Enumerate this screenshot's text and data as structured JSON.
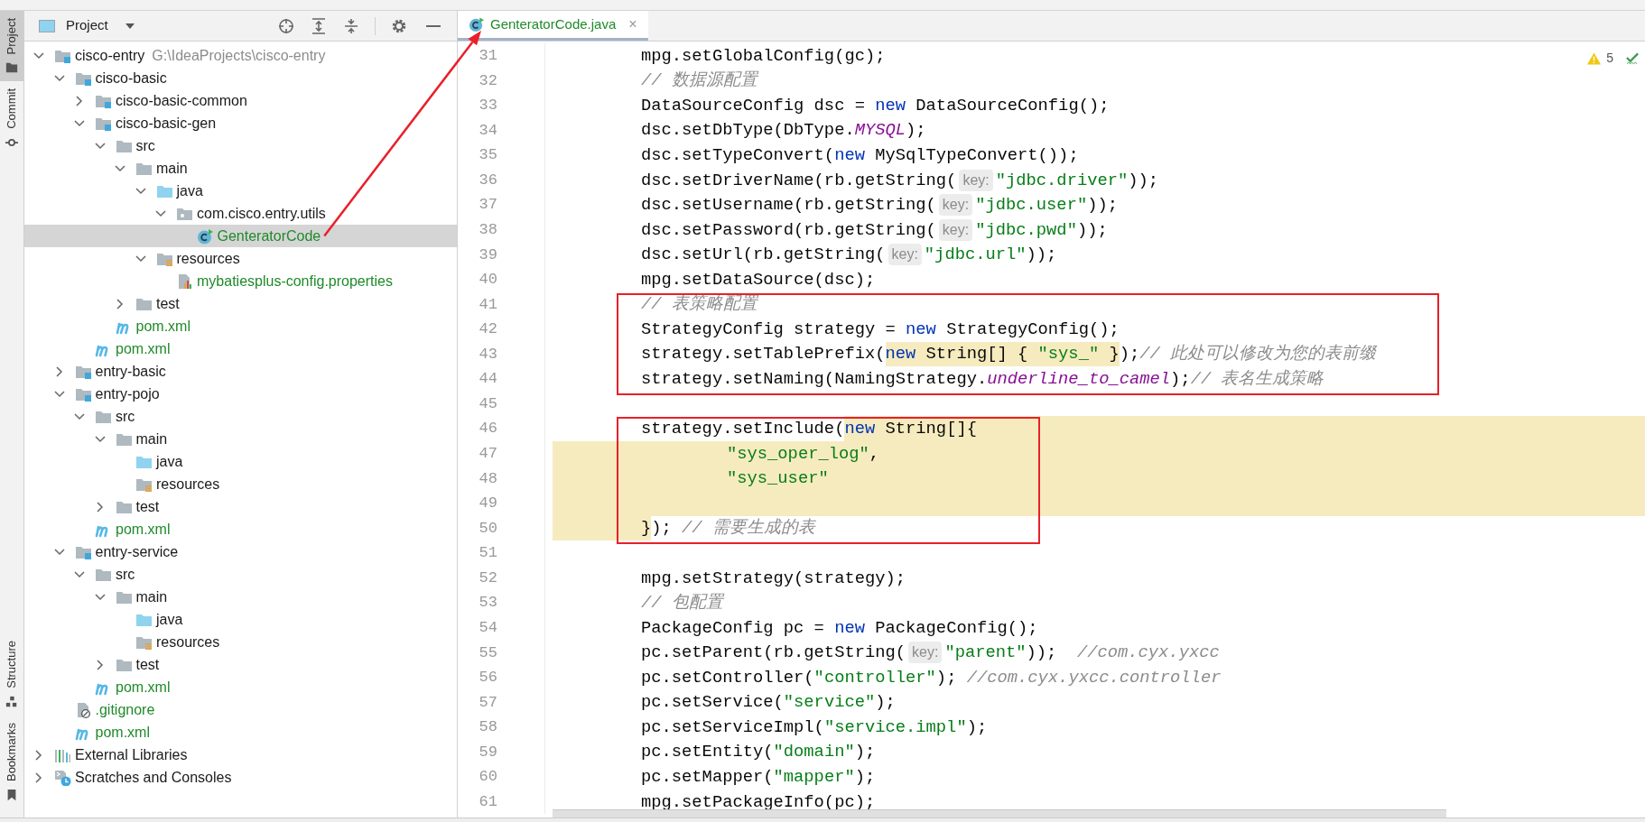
{
  "tool_strip": {
    "top": [
      {
        "label": "Project",
        "kind": "folder",
        "selected": true
      },
      {
        "label": "Commit",
        "kind": "commit",
        "selected": false
      }
    ],
    "bottom": [
      {
        "label": "Structure",
        "kind": "structure",
        "selected": false
      },
      {
        "label": "Bookmarks",
        "kind": "bookmark",
        "selected": false
      }
    ]
  },
  "project_panel": {
    "title": "Project",
    "tree": [
      {
        "name": "cisco-entry",
        "path": "G:\\IdeaProjects\\cisco-entry",
        "kind": "module",
        "expanded": true,
        "selected": false,
        "added": false,
        "children": [
          {
            "name": "cisco-basic",
            "kind": "module",
            "expanded": true,
            "selected": false,
            "added": false,
            "children": [
              {
                "name": "cisco-basic-common",
                "kind": "module",
                "expanded": false,
                "selected": false,
                "added": false
              },
              {
                "name": "cisco-basic-gen",
                "kind": "module",
                "expanded": true,
                "selected": false,
                "added": false,
                "children": [
                  {
                    "name": "src",
                    "kind": "folder",
                    "expanded": true,
                    "selected": false,
                    "added": false,
                    "children": [
                      {
                        "name": "main",
                        "kind": "folder",
                        "expanded": true,
                        "selected": false,
                        "added": false,
                        "children": [
                          {
                            "name": "java",
                            "kind": "source-folder",
                            "expanded": true,
                            "selected": false,
                            "added": false,
                            "children": [
                              {
                                "name": "com.cisco.entry.utils",
                                "kind": "package",
                                "expanded": true,
                                "selected": false,
                                "added": false,
                                "children": [
                                  {
                                    "name": "GenteratorCode",
                                    "kind": "class",
                                    "selected": true,
                                    "added": true
                                  }
                                ]
                              }
                            ]
                          },
                          {
                            "name": "resources",
                            "kind": "resource-folder",
                            "expanded": true,
                            "selected": false,
                            "added": false,
                            "children": [
                              {
                                "name": "mybatiesplus-config.properties",
                                "kind": "properties",
                                "selected": false,
                                "added": true
                              }
                            ]
                          }
                        ]
                      },
                      {
                        "name": "test",
                        "kind": "folder",
                        "expanded": false,
                        "selected": false,
                        "added": false
                      }
                    ]
                  },
                  {
                    "name": "pom.xml",
                    "kind": "maven",
                    "selected": false,
                    "added": true
                  }
                ]
              },
              {
                "name": "pom.xml",
                "kind": "maven",
                "selected": false,
                "added": true
              }
            ]
          },
          {
            "name": "entry-basic",
            "kind": "module",
            "expanded": false,
            "selected": false,
            "added": false
          },
          {
            "name": "entry-pojo",
            "kind": "module",
            "expanded": true,
            "selected": false,
            "added": false,
            "children": [
              {
                "name": "src",
                "kind": "folder",
                "expanded": true,
                "selected": false,
                "added": false,
                "children": [
                  {
                    "name": "main",
                    "kind": "folder",
                    "expanded": true,
                    "selected": false,
                    "added": false,
                    "children": [
                      {
                        "name": "java",
                        "kind": "source-folder",
                        "selected": false,
                        "added": false
                      },
                      {
                        "name": "resources",
                        "kind": "resource-folder",
                        "selected": false,
                        "added": false
                      }
                    ]
                  },
                  {
                    "name": "test",
                    "kind": "folder",
                    "expanded": false,
                    "selected": false,
                    "added": false
                  }
                ]
              },
              {
                "name": "pom.xml",
                "kind": "maven",
                "selected": false,
                "added": true
              }
            ]
          },
          {
            "name": "entry-service",
            "kind": "module",
            "expanded": true,
            "selected": false,
            "added": false,
            "children": [
              {
                "name": "src",
                "kind": "folder",
                "expanded": true,
                "selected": false,
                "added": false,
                "children": [
                  {
                    "name": "main",
                    "kind": "folder",
                    "expanded": true,
                    "selected": false,
                    "added": false,
                    "children": [
                      {
                        "name": "java",
                        "kind": "source-folder",
                        "selected": false,
                        "added": false
                      },
                      {
                        "name": "resources",
                        "kind": "resource-folder",
                        "selected": false,
                        "added": false
                      }
                    ]
                  },
                  {
                    "name": "test",
                    "kind": "folder",
                    "expanded": false,
                    "selected": false,
                    "added": false
                  }
                ]
              },
              {
                "name": "pom.xml",
                "kind": "maven",
                "selected": false,
                "added": true
              }
            ]
          },
          {
            "name": ".gitignore",
            "kind": "gitignore",
            "selected": false,
            "added": true
          },
          {
            "name": "pom.xml",
            "kind": "maven",
            "selected": false,
            "added": true
          }
        ]
      },
      {
        "name": "External Libraries",
        "kind": "libraries",
        "expanded": false,
        "selected": false,
        "added": false
      },
      {
        "name": "Scratches and Consoles",
        "kind": "scratches",
        "expanded": false,
        "selected": false,
        "added": false
      }
    ]
  },
  "editor": {
    "tabs": [
      {
        "label": "GenteratorCode.java",
        "close": "×",
        "selected": true,
        "added": true
      }
    ],
    "inspections": {
      "warnings": "5"
    },
    "sections": [
      {
        "outlined": false,
        "lines": [
          {
            "number": "31",
            "tokens": [
              {
                "kind": "plain",
                "text": "mpg.setGlobalConfig(gc);"
              }
            ]
          },
          {
            "number": "32",
            "tokens": [
              {
                "kind": "comment",
                "text": "// 数据源配置"
              }
            ]
          },
          {
            "number": "33",
            "tokens": [
              {
                "kind": "plain",
                "text": "DataSourceConfig dsc = "
              },
              {
                "kind": "keyword",
                "text": "new"
              },
              {
                "kind": "plain",
                "text": " DataSourceConfig();"
              }
            ]
          },
          {
            "number": "34",
            "tokens": [
              {
                "kind": "plain",
                "text": "dsc.setDbType(DbType."
              },
              {
                "kind": "static",
                "text": "MYSQL"
              },
              {
                "kind": "plain",
                "text": ");"
              }
            ]
          },
          {
            "number": "35",
            "tokens": [
              {
                "kind": "plain",
                "text": "dsc.setTypeConvert("
              },
              {
                "kind": "keyword",
                "text": "new"
              },
              {
                "kind": "plain",
                "text": " MySqlTypeConvert());"
              }
            ]
          },
          {
            "number": "36",
            "tokens": [
              {
                "kind": "plain",
                "text": "dsc.setDriverName(rb.getString("
              },
              {
                "kind": "hint",
                "text": "key:"
              },
              {
                "kind": "string",
                "text": "\"jdbc.driver\""
              },
              {
                "kind": "plain",
                "text": "));"
              }
            ]
          },
          {
            "number": "37",
            "tokens": [
              {
                "kind": "plain",
                "text": "dsc.setUsername(rb.getString("
              },
              {
                "kind": "hint",
                "text": "key:"
              },
              {
                "kind": "string",
                "text": "\"jdbc.user\""
              },
              {
                "kind": "plain",
                "text": "));"
              }
            ]
          },
          {
            "number": "38",
            "tokens": [
              {
                "kind": "plain",
                "text": "dsc.setPassword(rb.getString("
              },
              {
                "kind": "hint",
                "text": "key:"
              },
              {
                "kind": "string",
                "text": "\"jdbc.pwd\""
              },
              {
                "kind": "plain",
                "text": "));"
              }
            ]
          },
          {
            "number": "39",
            "tokens": [
              {
                "kind": "plain",
                "text": "dsc.setUrl(rb.getString("
              },
              {
                "kind": "hint",
                "text": "key:"
              },
              {
                "kind": "string",
                "text": "\"jdbc.url\""
              },
              {
                "kind": "plain",
                "text": "));"
              }
            ]
          },
          {
            "number": "40",
            "tokens": [
              {
                "kind": "plain",
                "text": "mpg.setDataSource(dsc);"
              }
            ]
          }
        ]
      },
      {
        "outlined": true,
        "lines": [
          {
            "number": "41",
            "tokens": [
              {
                "kind": "comment",
                "text": "// 表策略配置"
              }
            ]
          },
          {
            "number": "42",
            "tokens": [
              {
                "kind": "plain",
                "text": "StrategyConfig strategy = "
              },
              {
                "kind": "keyword",
                "text": "new"
              },
              {
                "kind": "plain",
                "text": " StrategyConfig();"
              }
            ]
          },
          {
            "number": "43",
            "tokens": [
              {
                "kind": "plain",
                "text": "strategy.setTablePrefix("
              },
              {
                "kind": "keyword",
                "text": "new",
                "marked": true
              },
              {
                "kind": "plain",
                "text": " String[] { ",
                "marked": true
              },
              {
                "kind": "string",
                "text": "\"sys_\"",
                "marked": true
              },
              {
                "kind": "plain",
                "text": " }",
                "marked": true
              },
              {
                "kind": "plain",
                "text": ");"
              },
              {
                "kind": "comment",
                "text": "// 此处可以修改为您的表前缀"
              }
            ]
          },
          {
            "number": "44",
            "tokens": [
              {
                "kind": "plain",
                "text": "strategy.setNaming(NamingStrategy."
              },
              {
                "kind": "static",
                "text": "underline_to_camel"
              },
              {
                "kind": "plain",
                "text": ");"
              },
              {
                "kind": "comment",
                "text": "// 表名生成策略"
              }
            ]
          }
        ]
      },
      {
        "outlined": false,
        "lines": [
          {
            "number": "45",
            "kind": "code"
          }
        ]
      },
      {
        "outlined": true,
        "lines": [
          {
            "number": "46",
            "kind": "marked-tail",
            "tokens": [
              {
                "kind": "plain",
                "text": "strategy.setInclude("
              },
              {
                "kind": "keyword",
                "text": "new",
                "marked": true
              },
              {
                "kind": "plain",
                "text": " String[]{",
                "marked": true
              }
            ]
          },
          {
            "number": "47",
            "kind": "marked-full",
            "continuation": true,
            "tokens": [
              {
                "kind": "string",
                "text": "\"sys_oper_log\""
              },
              {
                "kind": "plain",
                "text": ","
              }
            ]
          },
          {
            "number": "48",
            "kind": "marked-full",
            "continuation": true,
            "tokens": [
              {
                "kind": "string",
                "text": "\"sys_user\""
              }
            ]
          },
          {
            "number": "49",
            "kind": "marked-full"
          },
          {
            "number": "50",
            "kind": "marked-head",
            "tokens": [
              {
                "kind": "plain",
                "text": "}",
                "marked": true
              },
              {
                "kind": "plain",
                "text": "); "
              },
              {
                "kind": "comment",
                "text": "// 需要生成的表"
              }
            ]
          }
        ]
      },
      {
        "outlined": false,
        "lines": [
          {
            "number": "51",
            "kind": "code"
          },
          {
            "number": "52",
            "tokens": [
              {
                "kind": "plain",
                "text": "mpg.setStrategy(strategy);"
              }
            ]
          },
          {
            "number": "53",
            "tokens": [
              {
                "kind": "comment",
                "text": "// 包配置"
              }
            ]
          },
          {
            "number": "54",
            "tokens": [
              {
                "kind": "plain",
                "text": "PackageConfig pc = "
              },
              {
                "kind": "keyword",
                "text": "new"
              },
              {
                "kind": "plain",
                "text": " PackageConfig();"
              }
            ]
          },
          {
            "number": "55",
            "tokens": [
              {
                "kind": "plain",
                "text": "pc.setParent(rb.getString("
              },
              {
                "kind": "hint",
                "text": "key:"
              },
              {
                "kind": "string",
                "text": "\"parent\""
              },
              {
                "kind": "plain",
                "text": "));  "
              },
              {
                "kind": "comment",
                "text": "//com.cyx.yxcc"
              }
            ]
          },
          {
            "number": "56",
            "tokens": [
              {
                "kind": "plain",
                "text": "pc.setController("
              },
              {
                "kind": "string",
                "text": "\"controller\""
              },
              {
                "kind": "plain",
                "text": "); "
              },
              {
                "kind": "comment",
                "text": "//com.cyx.yxcc.controller"
              }
            ]
          },
          {
            "number": "57",
            "tokens": [
              {
                "kind": "plain",
                "text": "pc.setService("
              },
              {
                "kind": "string",
                "text": "\"service\""
              },
              {
                "kind": "plain",
                "text": ");"
              }
            ]
          },
          {
            "number": "58",
            "tokens": [
              {
                "kind": "plain",
                "text": "pc.setServiceImpl("
              },
              {
                "kind": "string",
                "text": "\"service.impl\""
              },
              {
                "kind": "plain",
                "text": ");"
              }
            ]
          },
          {
            "number": "59",
            "tokens": [
              {
                "kind": "plain",
                "text": "pc.setEntity("
              },
              {
                "kind": "string",
                "text": "\"domain\""
              },
              {
                "kind": "plain",
                "text": ");"
              }
            ]
          },
          {
            "number": "60",
            "tokens": [
              {
                "kind": "plain",
                "text": "pc.setMapper("
              },
              {
                "kind": "string",
                "text": "\"mapper\""
              },
              {
                "kind": "plain",
                "text": ");"
              }
            ]
          },
          {
            "number": "61",
            "tokens": [
              {
                "kind": "plain",
                "text": "mpg.setPackageInfo(pc);"
              }
            ]
          }
        ]
      }
    ]
  },
  "pointer_arrow": true
}
